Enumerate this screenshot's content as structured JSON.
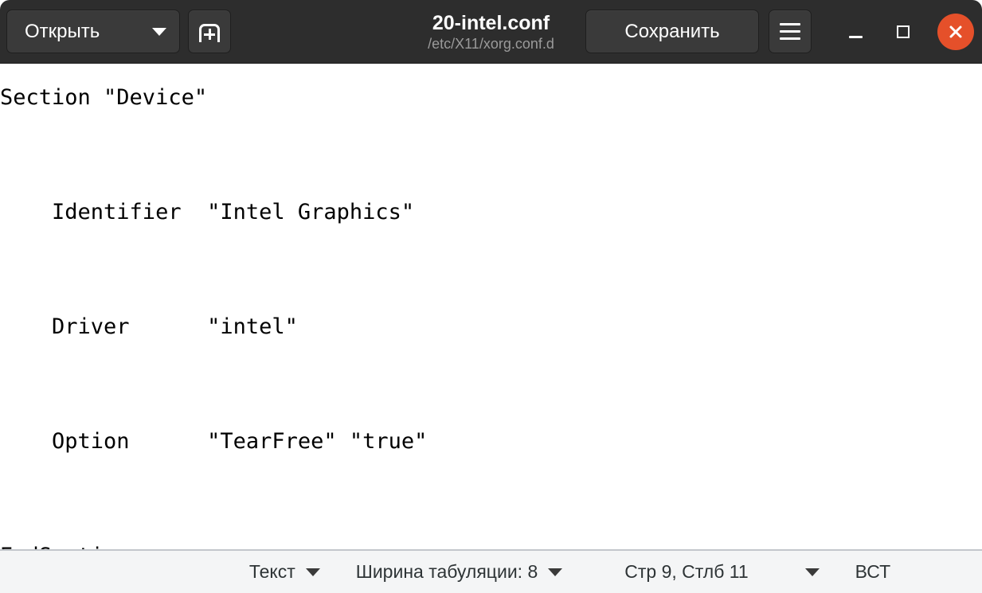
{
  "window": {
    "title": "20-intel.conf",
    "subtitle": "/etc/X11/xorg.conf.d"
  },
  "headerbar": {
    "open_label": "Открыть",
    "open_caret_icon": "chevron-down-icon",
    "new_document_icon": "new-document-icon",
    "save_label": "Сохранить",
    "menu_icon": "hamburger-menu-icon",
    "minimize_icon": "minimize-icon",
    "maximize_icon": "maximize-icon",
    "close_icon": "close-icon"
  },
  "editor": {
    "content": "Section \"Device\"\n\n    Identifier  \"Intel Graphics\"\n\n    Driver      \"intel\"\n\n    Option      \"TearFree\" \"true\"\n\nEndSection"
  },
  "statusbar": {
    "language": "Текст",
    "language_caret_icon": "chevron-down-icon",
    "tab_width": "Ширина табуляции: 8",
    "tab_width_caret_icon": "chevron-down-icon",
    "position": "Стр 9, Стлб 11",
    "position_caret_icon": "chevron-down-icon",
    "insert_mode": "ВСТ"
  },
  "colors": {
    "header_bg": "#2d2d2d",
    "button_bg": "#3a3a3a",
    "close_bg": "#e5502a",
    "editor_bg": "#ffffff",
    "editor_fg": "#000000",
    "statusbar_bg": "#f4f5f6",
    "statusbar_fg": "#2e3436",
    "subtitle_fg": "#9a9a9a"
  }
}
